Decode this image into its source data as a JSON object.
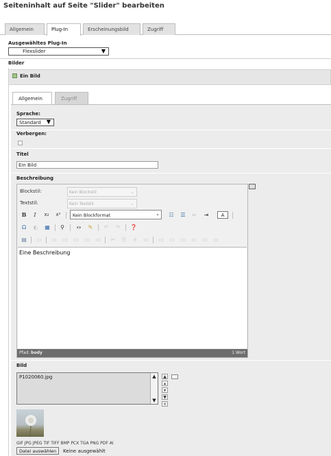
{
  "page": {
    "title": "Seiteninhalt auf Seite \"Slider\" bearbeiten"
  },
  "main_tabs": [
    {
      "label": "Allgemein",
      "active": false
    },
    {
      "label": "Plug-In",
      "active": true
    },
    {
      "label": "Erscheinungsbild",
      "active": false
    },
    {
      "label": "Zugriff",
      "active": false
    }
  ],
  "plugin": {
    "label": "Ausgewähltes Plug-In",
    "selected": "Flexslider"
  },
  "bilder": {
    "section_label": "Bilder",
    "item_title": "Ein Bild",
    "sub_tabs": [
      {
        "label": "Allgemein",
        "active": true
      },
      {
        "label": "Zugriff",
        "active": false
      }
    ],
    "sprache": {
      "label": "Sprache:",
      "selected": "Standard"
    },
    "verbergen": {
      "label": "Verbergen:",
      "checked": false
    },
    "titel": {
      "label": "Titel",
      "value": "Ein Bild"
    },
    "beschreibung": {
      "label": "Beschreibung",
      "blockstil_label": "Blockstil:",
      "blockstil_value": "Kein Blockstil",
      "textstil_label": "Textstil:",
      "textstil_value": "Kein Textstil",
      "blockformat_value": "Kein Blockformat",
      "text_color_btn": "A",
      "content": "Eine Beschreibung",
      "path_label": "Pfad:",
      "path_value": "body",
      "word_count": "1 Wort"
    },
    "bild": {
      "label": "Bild",
      "filename": "P1020060.jpg",
      "allowed_types": "GIF JPG JPEG TIF TIFF BMP PCX TGA PNG PDF AI",
      "choose_button": "Datei auswählen",
      "no_file_text": "Keine ausgewählt"
    }
  },
  "colors": {
    "tab_inactive": "#e2e2e2",
    "section_bg": "#ececec",
    "statusbar": "#6d6d6d"
  }
}
